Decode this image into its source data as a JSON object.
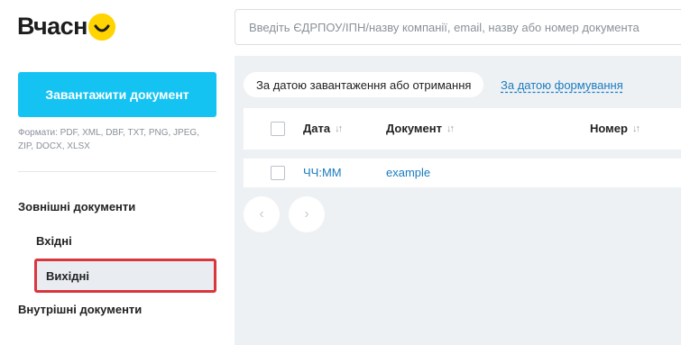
{
  "header": {
    "logo_text": "Вчасн",
    "search_placeholder": "Введіть ЄДРПОУ/ІПН/назву компанії, email, назву або номер документа"
  },
  "sidebar": {
    "upload_label": "Завантажити документ",
    "formats": "Формати: PDF, XML, DBF, TXT, PNG, JPEG, ZIP, DOCX, XLSX",
    "nav": {
      "external": "Зовнішні документи",
      "incoming": "Вхідні",
      "outgoing": "Вихідні",
      "internal": "Внутрішні документи"
    }
  },
  "main": {
    "sort_by_upload": "За датою завантаження або отримання",
    "sort_by_creation": "За датою формування",
    "columns": {
      "date": "Дата",
      "document": "Документ",
      "number": "Номер"
    },
    "rows": [
      {
        "date": "ЧЧ:ММ",
        "document": "example"
      }
    ],
    "pager": {
      "prev": "‹",
      "next": "›"
    }
  },
  "colors": {
    "accent": "#15c3f3",
    "logo_yellow": "#ffd400",
    "link": "#1a7bbf",
    "highlight_border": "#d9363e"
  },
  "icons": {
    "sort": "sort-arrows-icon",
    "logo_mark": "smile-logo-icon"
  }
}
